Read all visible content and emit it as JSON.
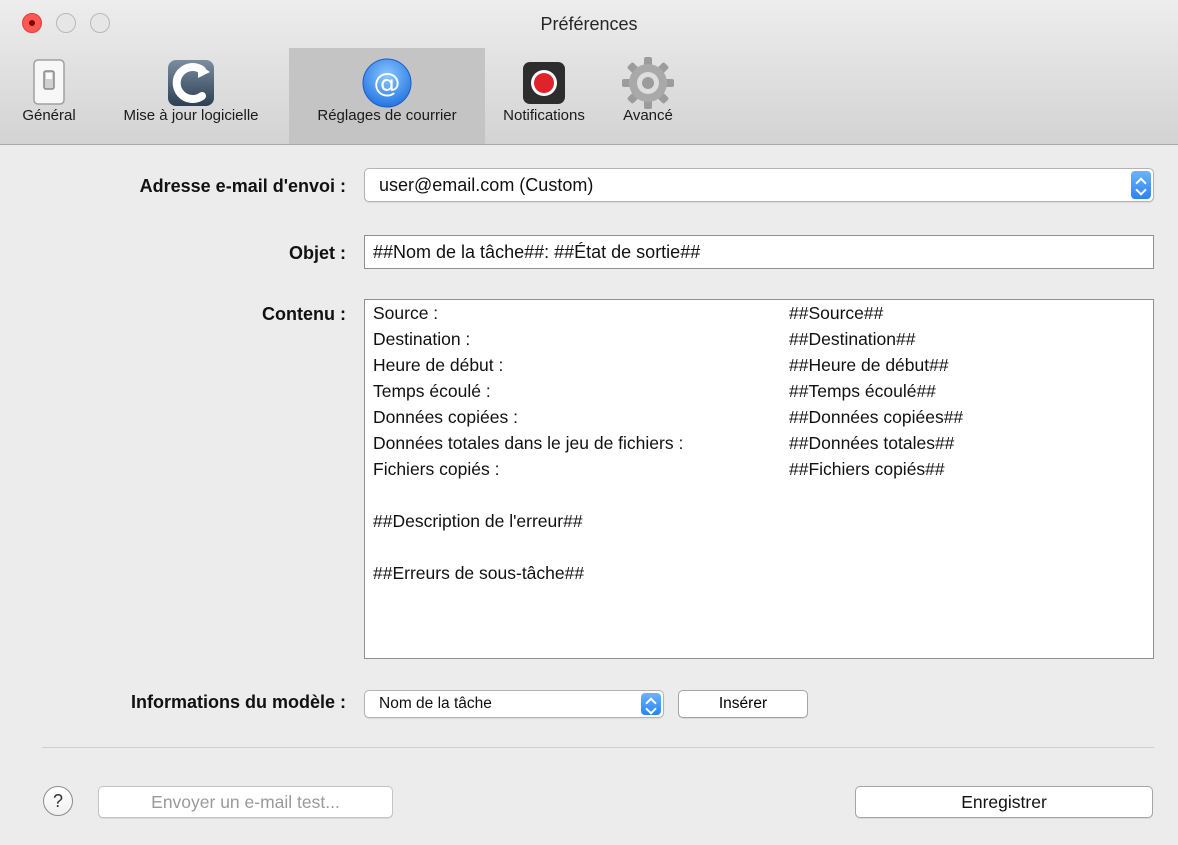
{
  "window": {
    "title": "Préférences"
  },
  "toolbar": {
    "tabs": [
      {
        "label": "Général",
        "icon": "general-switch-icon"
      },
      {
        "label": "Mise à jour logicielle",
        "icon": "software-update-icon"
      },
      {
        "label": "Réglages de courrier",
        "icon": "mail-at-icon",
        "active": true
      },
      {
        "label": "Notifications",
        "icon": "notification-record-icon"
      },
      {
        "label": "Avancé",
        "icon": "gear-icon"
      }
    ]
  },
  "form": {
    "sender_label": "Adresse e-mail d'envoi :",
    "sender_value": "user@email.com (Custom)",
    "subject_label": "Objet :",
    "subject_value": "##Nom de la tâche##: ##État de sortie##",
    "content_label": "Contenu :",
    "content_lines": [
      {
        "label": "Source :",
        "token": "##Source##"
      },
      {
        "label": "Destination :",
        "token": "##Destination##"
      },
      {
        "label": "Heure de début :",
        "token": "##Heure de début##"
      },
      {
        "label": "Temps écoulé :",
        "token": "##Temps écoulé##"
      },
      {
        "label": "Données copiées :",
        "token": "##Données copiées##"
      },
      {
        "label": "Données totales dans le jeu de fichiers :",
        "token": "##Données totales##"
      },
      {
        "label": "Fichiers copiés :",
        "token": "##Fichiers copiés##"
      },
      {
        "label": "",
        "token": ""
      },
      {
        "label": "##Description de l'erreur##",
        "token": ""
      },
      {
        "label": "",
        "token": ""
      },
      {
        "label": "##Erreurs de sous-tâche##",
        "token": ""
      }
    ],
    "template_label": "Informations du modèle :",
    "template_value": "Nom de la tâche",
    "insert_button": "Insérer"
  },
  "footer": {
    "help_glyph": "?",
    "test_button": "Envoyer un e-mail test...",
    "save_button": "Enregistrer"
  },
  "colors": {
    "accent_blue": "#2a83f5",
    "close_red": "#fc5753",
    "active_tab_bg": "#c4c4c4"
  }
}
